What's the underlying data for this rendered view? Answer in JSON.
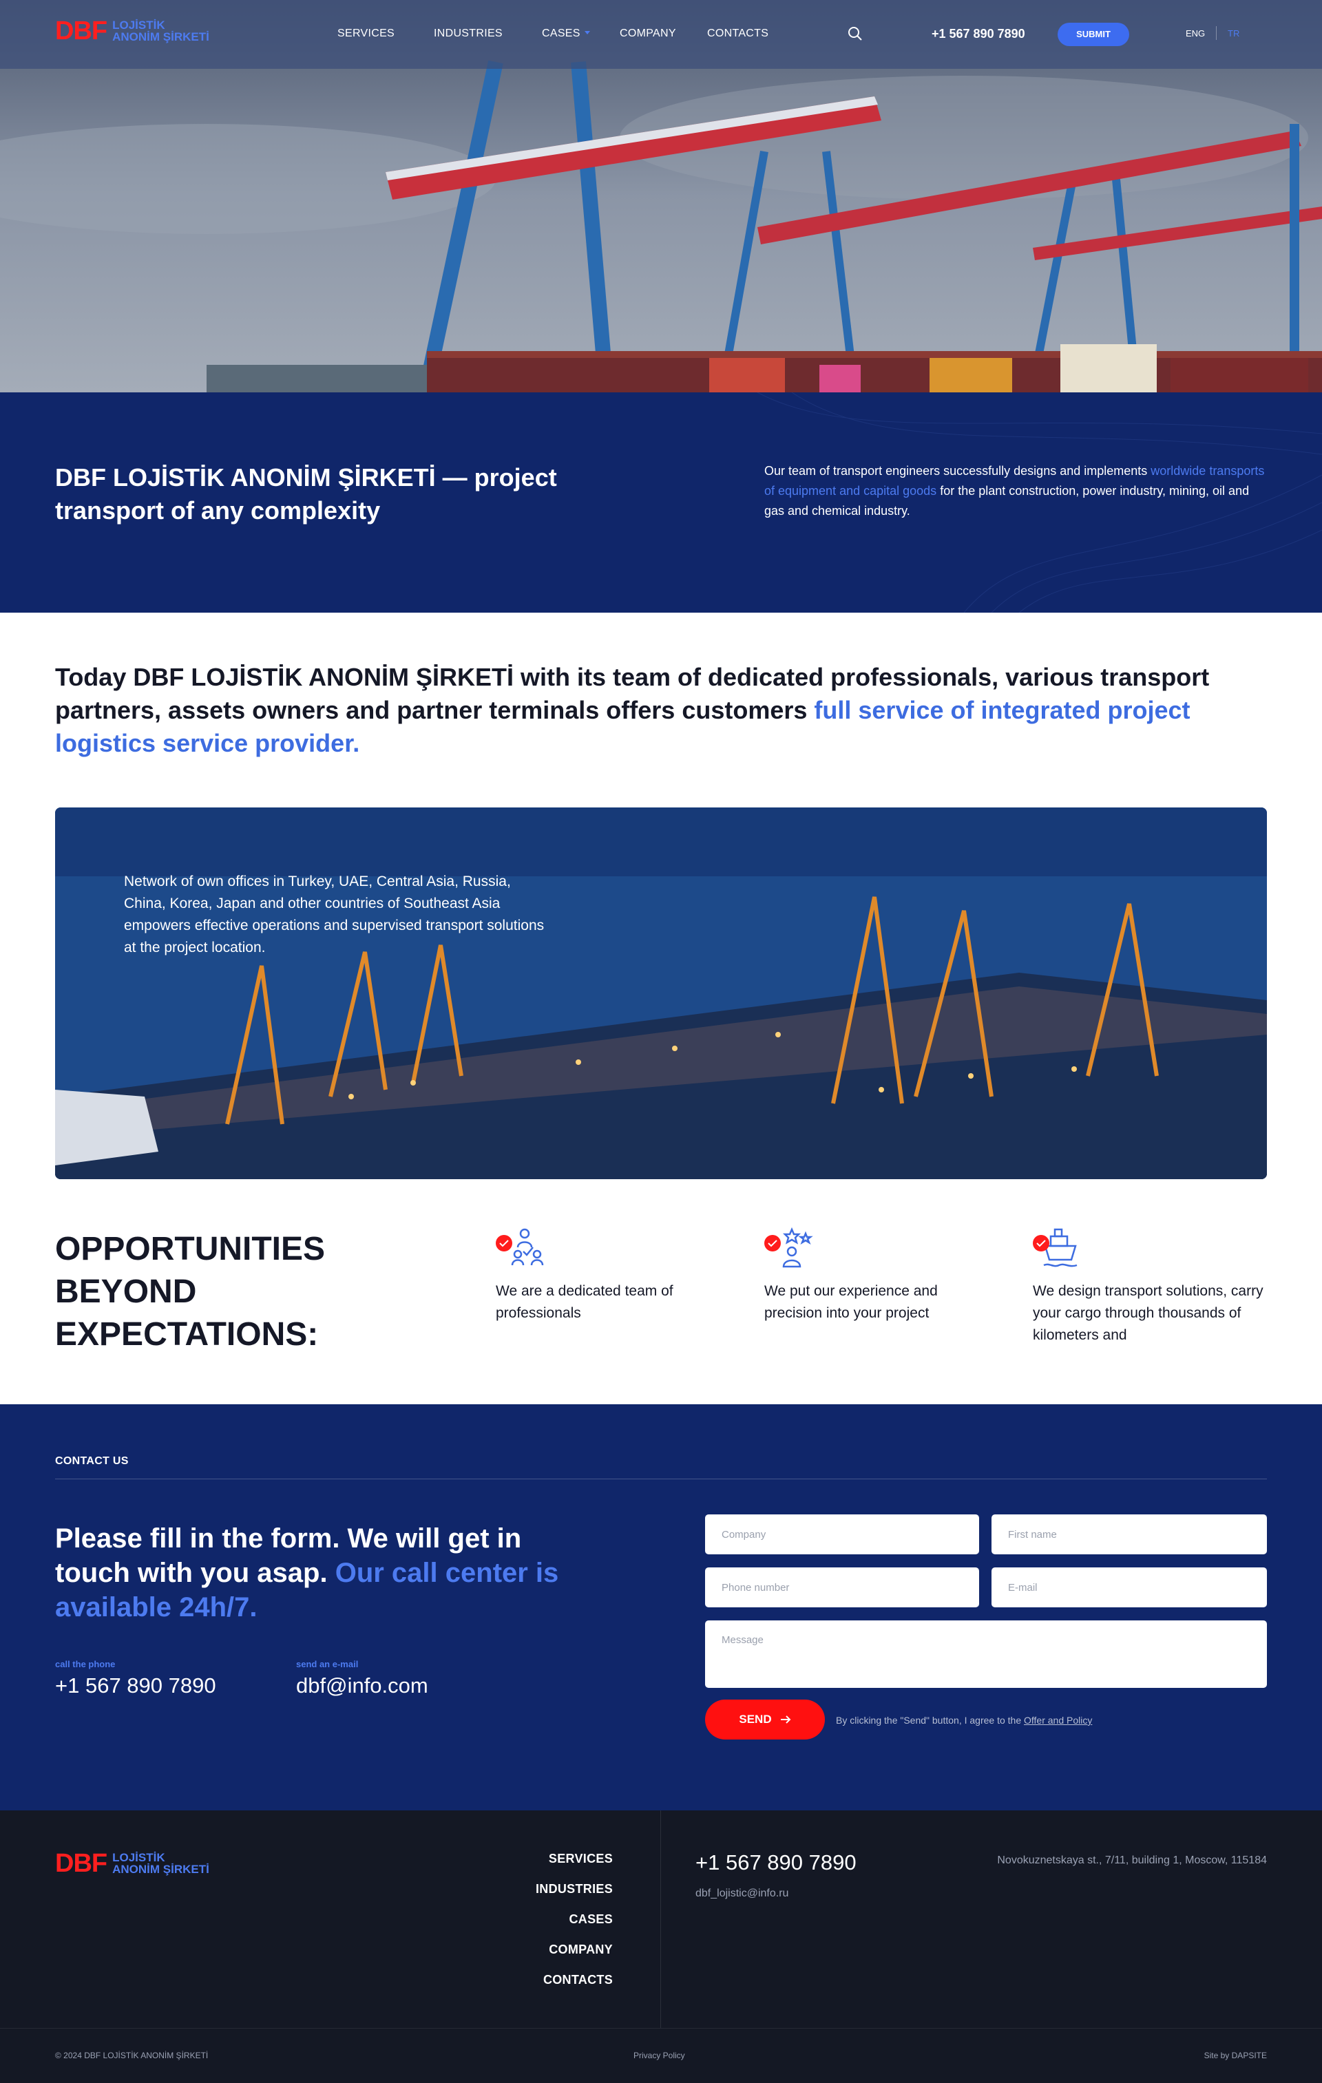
{
  "header": {
    "logo_mark": "DBF",
    "logo_line1": "LOJİSTİK",
    "logo_line2": "ANONİM ŞİRKETİ",
    "nav": [
      "SERVICES",
      "INDUSTRIES",
      "CASES",
      "COMPANY",
      "CONTACTS"
    ],
    "phone": "+1 567 890 7890",
    "submit_label": "SUBMIT",
    "lang_active": "ENG",
    "lang_other": "TR"
  },
  "intro": {
    "title": "DBF LOJİSTİK ANONİM ŞİRKETİ — project transport of any complexity",
    "text_before": "Our team of transport engineers successfully designs and implements ",
    "text_accent": "worldwide transports of equipment and capital goods",
    "text_after": " for the plant construction, power industry, mining, oil and gas and chemical industry."
  },
  "statement": {
    "text": "Today DBF LOJİSTİK ANONİM ŞİRKETİ with its team of dedicated professionals, various transport partners, assets owners and partner terminals offers customers ",
    "accent": "full service of integrated project logistics service provider."
  },
  "network": {
    "text": "Network of own offices in Turkey, UAE, Central Asia, Russia, China, Korea, Japan and other countries of Southeast Asia empowers effective operations and supervised transport solutions at the project location."
  },
  "opportunities": {
    "title": "OPPORTUNITIES BEYOND EXPECTATIONS:",
    "features": [
      {
        "icon": "team-check-icon",
        "text": "We are a dedicated team of professionals"
      },
      {
        "icon": "experience-stars-icon",
        "text": "We put our experience and precision into your project"
      },
      {
        "icon": "ship-icon",
        "text": "We design transport solutions, carry your cargo through thousands of kilometers and"
      }
    ]
  },
  "contact": {
    "label": "CONTACT US",
    "heading": "Please fill in the form. We will get in touch with you asap. ",
    "heading_accent": "Our call center is available 24h/7.",
    "phone_label": "call the phone",
    "phone": "+1 567 890 7890",
    "email_label": "send an e-mail",
    "email": "dbf@info.com",
    "form": {
      "company": "Company",
      "first_name": "First name",
      "phone": "Phone number",
      "email": "E-mail",
      "message": "Message",
      "send_label": "SEND",
      "note_text": "By clicking the \"Send\" button, I agree to the ",
      "note_link": "Offer and Policy"
    }
  },
  "footer": {
    "logo_mark": "DBF",
    "logo_line1": "LOJİSTİK",
    "logo_line2": "ANONİM ŞİRKETİ",
    "links": [
      "SERVICES",
      "INDUSTRIES",
      "CASES",
      "COMPANY",
      "CONTACTS"
    ],
    "phone": "+1 567 890 7890",
    "email": "dbf_lojistic@info.ru",
    "address": "Novokuznetskaya st., 7/11, building 1, Moscow, 115184",
    "copyright": "© 2024 DBF LOJİSTİK ANONİM ŞİRKETİ",
    "privacy": "Privacy Policy",
    "credit": "Site by DAPSITE"
  },
  "colors": {
    "navy": "#10266a",
    "accent_blue": "#4d7bf0",
    "brand_red": "#ff1f1f",
    "footer_bg": "#141824"
  }
}
